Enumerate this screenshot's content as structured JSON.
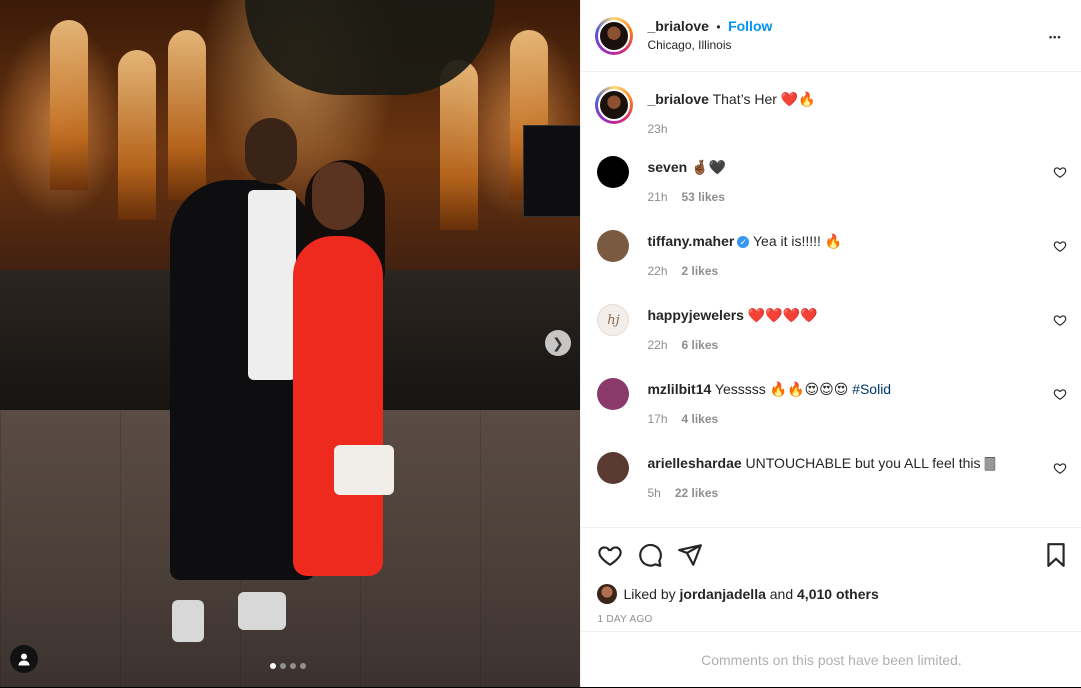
{
  "post": {
    "author": "_brialove",
    "follow_label": "Follow",
    "separator": "•",
    "location": "Chicago, Illinois",
    "more_label": "•••",
    "carousel": {
      "slides": 4,
      "active_index": 0
    }
  },
  "caption": {
    "user": "_brialove",
    "text": "That’s Her ❤️🔥",
    "time": "23h"
  },
  "comments": [
    {
      "user": "seven",
      "verified": false,
      "text": "🤞🏾🖤",
      "time": "21h",
      "likes": "53 likes",
      "avatar_color": "#000000"
    },
    {
      "user": "tiffany.maher",
      "verified": true,
      "text": "Yea it is!!!!! 🔥",
      "time": "22h",
      "likes": "2 likes",
      "avatar_color": "#7a5a40"
    },
    {
      "user": "happyjewelers",
      "verified": false,
      "text": "❤️❤️❤️❤️",
      "time": "22h",
      "likes": "6 likes",
      "avatar_color": "#f4eeea"
    },
    {
      "user": "mzlilbit14",
      "verified": false,
      "text": "Yesssss 🔥🔥😍😍😍 ",
      "hashtag": "#Solid",
      "time": "17h",
      "likes": "4 likes",
      "avatar_color": "#8a3a6a"
    },
    {
      "user": "arielleshardae",
      "verified": false,
      "text": "UNTOUCHABLE but you ALL feel this 🀫",
      "time": "5h",
      "likes": "22 likes",
      "avatar_color": "#5a3a30"
    }
  ],
  "likes": {
    "prefix": "Liked by",
    "user": "jordanjadella",
    "conjunction": "and",
    "others": "4,010 others"
  },
  "date_label": "1 DAY AGO",
  "comments_limited": "Comments on this post have been limited.",
  "avatar_monogram": "hj",
  "verified_mark": "✓"
}
